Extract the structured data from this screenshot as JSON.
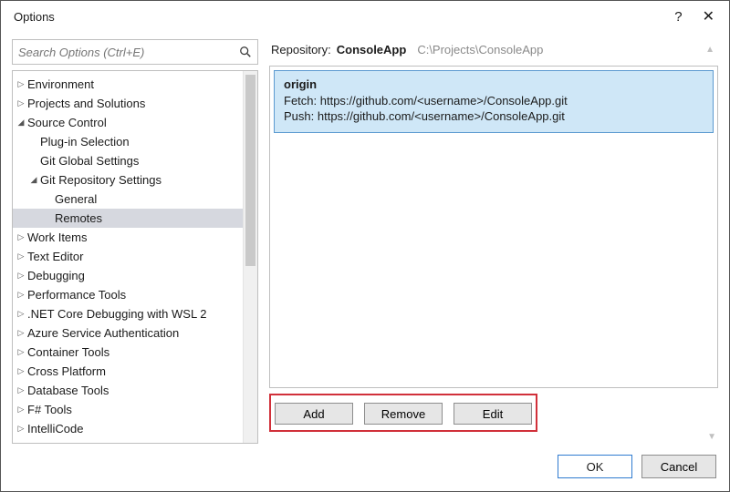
{
  "window": {
    "title": "Options",
    "help_icon": "?",
    "close_icon": "✕"
  },
  "search": {
    "placeholder": "Search Options (Ctrl+E)"
  },
  "tree": [
    {
      "label": "Environment",
      "indent": 0,
      "exp": "closed",
      "sel": false
    },
    {
      "label": "Projects and Solutions",
      "indent": 0,
      "exp": "closed",
      "sel": false
    },
    {
      "label": "Source Control",
      "indent": 0,
      "exp": "open",
      "sel": false
    },
    {
      "label": "Plug-in Selection",
      "indent": 1,
      "exp": "none",
      "sel": false
    },
    {
      "label": "Git Global Settings",
      "indent": 1,
      "exp": "none",
      "sel": false
    },
    {
      "label": "Git Repository Settings",
      "indent": 1,
      "exp": "open",
      "sel": false
    },
    {
      "label": "General",
      "indent": 2,
      "exp": "none",
      "sel": false
    },
    {
      "label": "Remotes",
      "indent": 2,
      "exp": "none",
      "sel": true
    },
    {
      "label": "Work Items",
      "indent": 0,
      "exp": "closed",
      "sel": false
    },
    {
      "label": "Text Editor",
      "indent": 0,
      "exp": "closed",
      "sel": false
    },
    {
      "label": "Debugging",
      "indent": 0,
      "exp": "closed",
      "sel": false
    },
    {
      "label": "Performance Tools",
      "indent": 0,
      "exp": "closed",
      "sel": false
    },
    {
      "label": ".NET Core Debugging with WSL 2",
      "indent": 0,
      "exp": "closed",
      "sel": false
    },
    {
      "label": "Azure Service Authentication",
      "indent": 0,
      "exp": "closed",
      "sel": false
    },
    {
      "label": "Container Tools",
      "indent": 0,
      "exp": "closed",
      "sel": false
    },
    {
      "label": "Cross Platform",
      "indent": 0,
      "exp": "closed",
      "sel": false
    },
    {
      "label": "Database Tools",
      "indent": 0,
      "exp": "closed",
      "sel": false
    },
    {
      "label": "F# Tools",
      "indent": 0,
      "exp": "closed",
      "sel": false
    },
    {
      "label": "IntelliCode",
      "indent": 0,
      "exp": "closed",
      "sel": false
    }
  ],
  "repo": {
    "label": "Repository:",
    "name": "ConsoleApp",
    "path": "C:\\Projects\\ConsoleApp"
  },
  "remote": {
    "name": "origin",
    "fetch_label": "Fetch:",
    "fetch_url": "https://github.com/<username>/ConsoleApp.git",
    "push_label": "Push:",
    "push_url": "https://github.com/<username>/ConsoleApp.git"
  },
  "buttons": {
    "add": "Add",
    "remove": "Remove",
    "edit": "Edit"
  },
  "footer": {
    "ok": "OK",
    "cancel": "Cancel"
  }
}
